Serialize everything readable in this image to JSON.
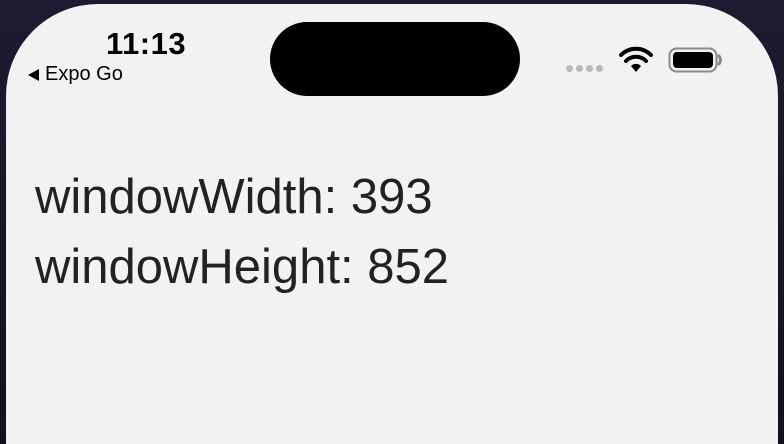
{
  "status_bar": {
    "time": "11:13",
    "back_label": "Expo Go"
  },
  "icons": {
    "wifi": "wifi-icon",
    "battery": "battery-icon",
    "signal": "cellular-signal-dots-icon",
    "back": "back-arrow-icon"
  },
  "content": {
    "window_width": "windowWidth: 393",
    "window_height": "windowHeight: 852"
  }
}
